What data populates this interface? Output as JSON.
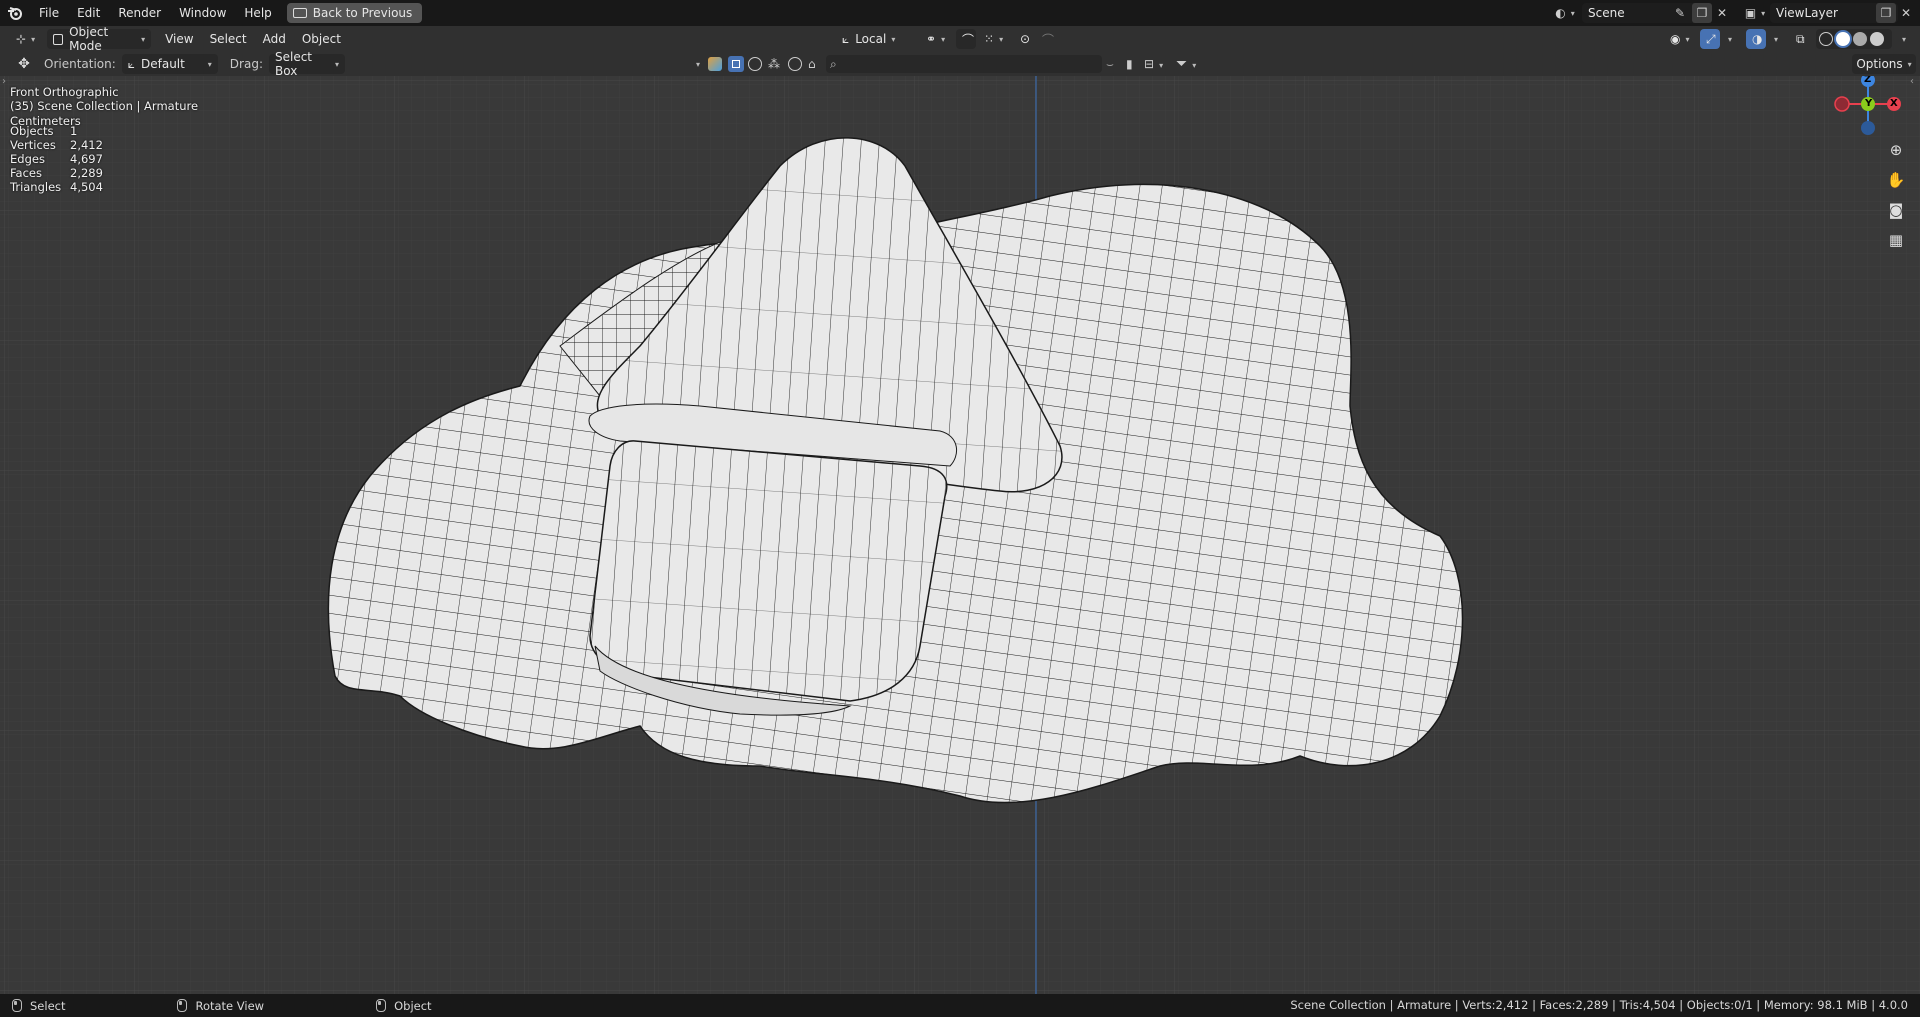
{
  "menu": {
    "items": [
      "File",
      "Edit",
      "Render",
      "Window",
      "Help"
    ],
    "back_button": "Back to Previous"
  },
  "top_right": {
    "scene": "Scene",
    "view_layer": "ViewLayer"
  },
  "header": {
    "mode": "Object Mode",
    "menus": [
      "View",
      "Select",
      "Add",
      "Object"
    ],
    "transform_orientation": "Local",
    "options": "Options"
  },
  "toolbar": {
    "orientation_label": "Orientation:",
    "orientation_value": "Default",
    "drag_label": "Drag:",
    "drag_value": "Select Box",
    "search_placeholder": ""
  },
  "viewport_info": {
    "view_name": "Front Orthographic",
    "collection": "(35) Scene Collection | Armature",
    "units": "Centimeters",
    "stats": [
      {
        "label": "Objects",
        "value": "1"
      },
      {
        "label": "Vertices",
        "value": "2,412"
      },
      {
        "label": "Edges",
        "value": "4,697"
      },
      {
        "label": "Faces",
        "value": "2,289"
      },
      {
        "label": "Triangles",
        "value": "4,504"
      }
    ]
  },
  "gizmo": {
    "z": "Z",
    "y": "Y",
    "x": "X"
  },
  "status": {
    "select": "Select",
    "rotate": "Rotate View",
    "object": "Object",
    "summary": "Scene Collection | Armature | Verts:2,412 | Faces:2,289 | Tris:4,504 | Objects:0/1 | Memory: 98.1 MiB | 4.0.0"
  },
  "colors": {
    "x_axis": "#e8404e",
    "y_axis": "#8acb1c",
    "z_axis": "#3d85e0",
    "mesh_fill": "#e8e8e8",
    "mesh_wire": "#111111",
    "accent": "#4772b3"
  }
}
